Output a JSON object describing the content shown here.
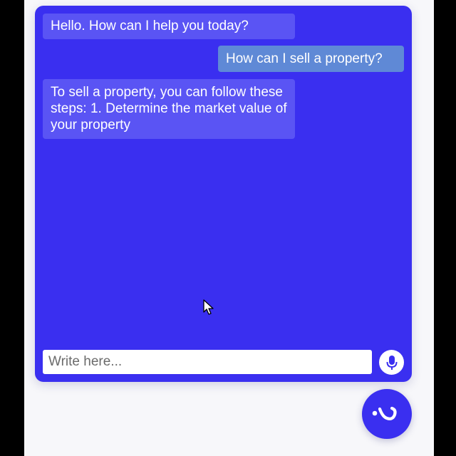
{
  "colors": {
    "accent": "#3a2ff0",
    "bot_bubble": "#5a54f4",
    "user_bubble": "#5f89d6",
    "background": "#f7f7fa"
  },
  "chat": {
    "messages": [
      {
        "sender": "bot",
        "text": "Hello. How can I help you today?"
      },
      {
        "sender": "user",
        "text": "How can I sell a property?"
      },
      {
        "sender": "bot",
        "text": "To sell a property, you can follow these steps: 1. Determine the market value of your property"
      }
    ]
  },
  "composer": {
    "placeholder": "Write here...",
    "value": "",
    "mic_icon": "microphone-icon"
  },
  "launcher": {
    "icon": "chat-logo-icon"
  }
}
